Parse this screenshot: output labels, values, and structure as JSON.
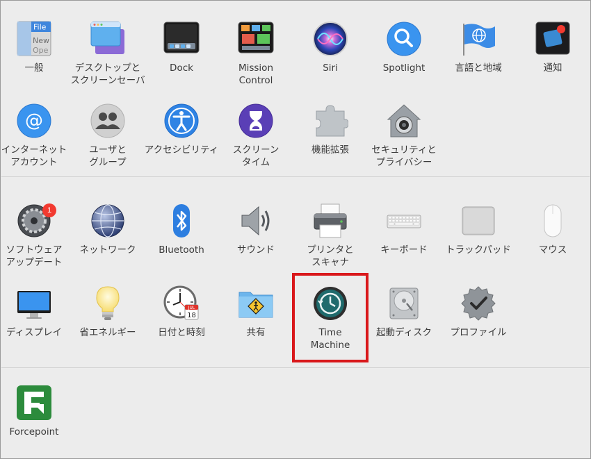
{
  "rows": {
    "row1": [
      {
        "id": "general",
        "label": "一般",
        "label2": "",
        "icon": "general-icon",
        "icon_text": [
          "File",
          "New",
          "Ope"
        ]
      },
      {
        "id": "desktop",
        "label": "デスクトップと",
        "label2": "スクリーンセーバ",
        "icon": "desktop-screensaver-icon"
      },
      {
        "id": "dock",
        "label": "Dock",
        "label2": "",
        "icon": "dock-icon"
      },
      {
        "id": "mission",
        "label": "Mission",
        "label2": "Control",
        "icon": "mission-control-icon"
      },
      {
        "id": "siri",
        "label": "Siri",
        "label2": "",
        "icon": "siri-icon"
      },
      {
        "id": "spotlight",
        "label": "Spotlight",
        "label2": "",
        "icon": "spotlight-icon"
      },
      {
        "id": "language",
        "label": "言語と地域",
        "label2": "",
        "icon": "language-region-icon"
      },
      {
        "id": "notify",
        "label": "通知",
        "label2": "",
        "icon": "notifications-icon"
      }
    ],
    "row2": [
      {
        "id": "internet",
        "label": "インターネット",
        "label2": "アカウント",
        "icon": "internet-accounts-icon"
      },
      {
        "id": "users",
        "label": "ユーザと",
        "label2": "グループ",
        "icon": "users-groups-icon"
      },
      {
        "id": "access",
        "label": "アクセシビリティ",
        "label2": "",
        "icon": "accessibility-icon"
      },
      {
        "id": "screentime",
        "label": "スクリーン",
        "label2": "タイム",
        "icon": "screen-time-icon"
      },
      {
        "id": "extensions",
        "label": "機能拡張",
        "label2": "",
        "icon": "extensions-icon"
      },
      {
        "id": "security",
        "label": "セキュリティと",
        "label2": "プライバシー",
        "icon": "security-privacy-icon"
      }
    ],
    "row3": [
      {
        "id": "update",
        "label": "ソフトウェア",
        "label2": "アップデート",
        "icon": "software-update-icon",
        "badge": "1"
      },
      {
        "id": "network",
        "label": "ネットワーク",
        "label2": "",
        "icon": "network-icon"
      },
      {
        "id": "bluetooth",
        "label": "Bluetooth",
        "label2": "",
        "icon": "bluetooth-icon"
      },
      {
        "id": "sound",
        "label": "サウンド",
        "label2": "",
        "icon": "sound-icon"
      },
      {
        "id": "printers",
        "label": "プリンタと",
        "label2": "スキャナ",
        "icon": "printer-scanner-icon"
      },
      {
        "id": "keyboard",
        "label": "キーボード",
        "label2": "",
        "icon": "keyboard-icon"
      },
      {
        "id": "trackpad",
        "label": "トラックパッド",
        "label2": "",
        "icon": "trackpad-icon"
      },
      {
        "id": "mouse",
        "label": "マウス",
        "label2": "",
        "icon": "mouse-icon"
      }
    ],
    "row4": [
      {
        "id": "displays",
        "label": "ディスプレイ",
        "label2": "",
        "icon": "displays-icon"
      },
      {
        "id": "energy",
        "label": "省エネルギー",
        "label2": "",
        "icon": "energy-saver-icon"
      },
      {
        "id": "datetime",
        "label": "日付と時刻",
        "label2": "",
        "icon": "date-time-icon",
        "icon_text": [
          "JUL",
          "18"
        ]
      },
      {
        "id": "sharing",
        "label": "共有",
        "label2": "",
        "icon": "sharing-icon"
      },
      {
        "id": "timemachine",
        "label": "Time",
        "label2": "Machine",
        "icon": "time-machine-icon"
      },
      {
        "id": "startup",
        "label": "起動ディスク",
        "label2": "",
        "icon": "startup-disk-icon"
      },
      {
        "id": "profiles",
        "label": "プロファイル",
        "label2": "",
        "icon": "profiles-icon"
      }
    ],
    "row5": [
      {
        "id": "forcepoint",
        "label": "Forcepoint",
        "label2": "",
        "icon": "forcepoint-icon"
      }
    ]
  },
  "colors": {
    "highlight": "#d9181b",
    "background": "#ececec",
    "badge": "#f23a30"
  }
}
